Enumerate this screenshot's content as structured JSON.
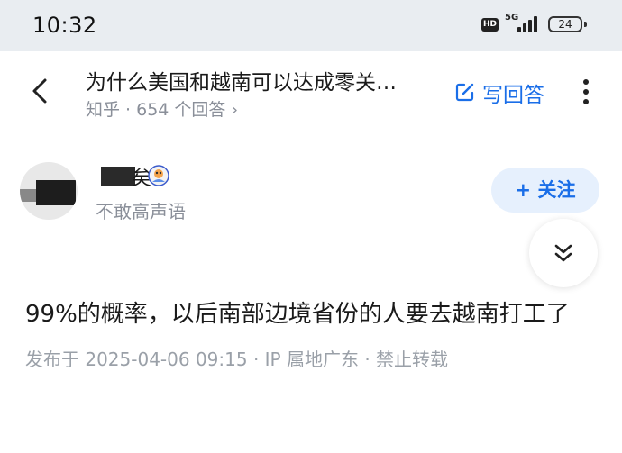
{
  "status_bar": {
    "time": "10:32",
    "hd_label": "HD",
    "network_label": "5G",
    "battery": "24"
  },
  "header": {
    "question_title": "为什么美国和越南可以达成零关…",
    "meta": "知乎 · 654 个回答 ›",
    "write_answer_label": "写回答",
    "accent_color": "#1a6ee8"
  },
  "author": {
    "name_visible_suffix": "矣",
    "bio": "不敢高声语",
    "follow_label": "+ 关注"
  },
  "answer": {
    "body": "99%的概率，以后南部边境省份的人要去越南打工了",
    "meta": "发布于 2025-04-06 09:15 · IP 属地广东 · 禁止转载"
  }
}
